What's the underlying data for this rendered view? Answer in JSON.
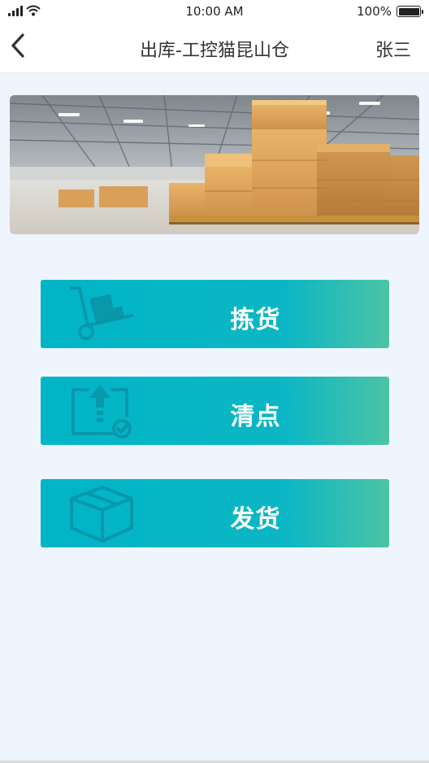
{
  "status_bar": {
    "time": "10:00 AM",
    "battery_text": "100%",
    "battery_level": 1.0
  },
  "nav": {
    "title": "出库-工控猫昆山仓",
    "user": "张三"
  },
  "actions": [
    {
      "label": "拣货",
      "icon": "hand-truck-icon"
    },
    {
      "label": "清点",
      "icon": "upload-check-icon"
    },
    {
      "label": "发货",
      "icon": "box-icon"
    }
  ],
  "colors": {
    "accent_start": "#00b5c6",
    "accent_end": "#4cc4a5",
    "background": "#eef5fd"
  }
}
